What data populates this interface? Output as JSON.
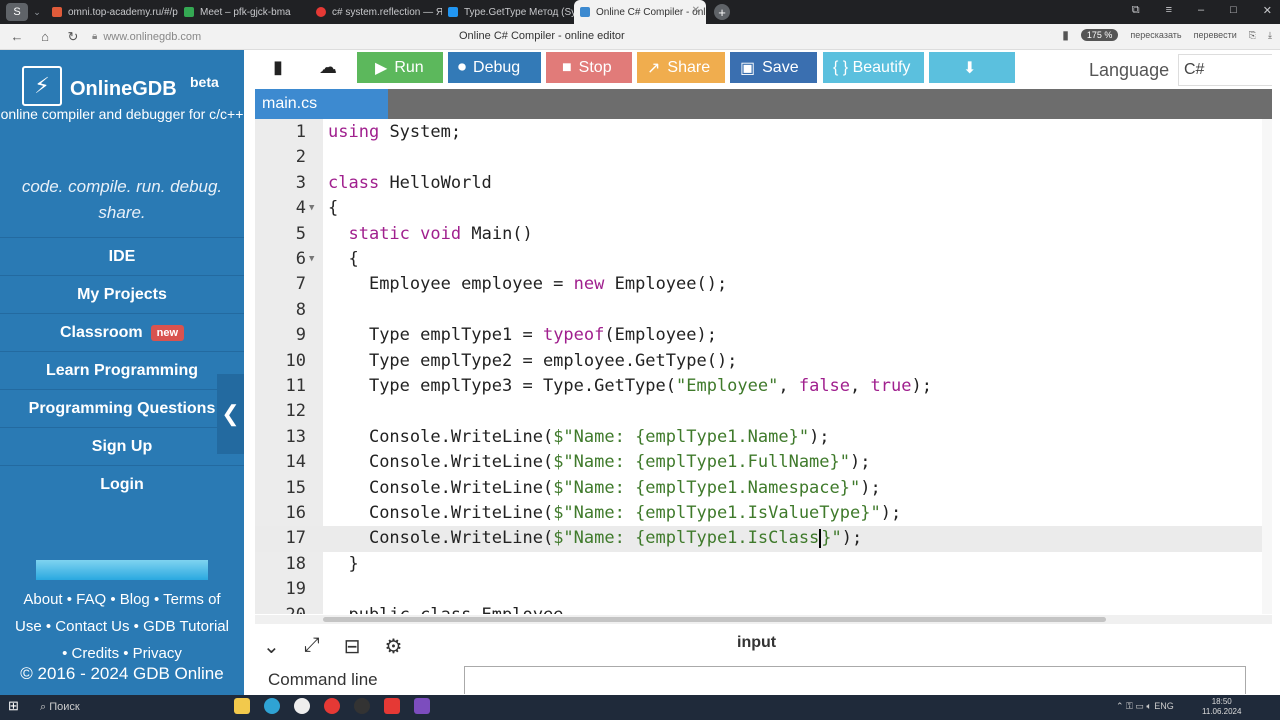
{
  "browser": {
    "tabs": [
      {
        "title": "omni.top-academy.ru/#/p",
        "color": "#e05b3a"
      },
      {
        "title": "Meet – pfk-gjck-bma",
        "color": "#34a853"
      },
      {
        "title": "c# system.reflection — Ян",
        "color": "#e53935"
      },
      {
        "title": "Type.GetType Метод (Sys",
        "color": "#2196f3"
      },
      {
        "title": "Online C# Compiler - onl",
        "color": "#3d8ad0",
        "active": true
      }
    ],
    "url": "www.onlinegdb.com",
    "page_title": "Online C# Compiler - online editor",
    "zoom": "175 %",
    "retell": "пересказать",
    "translate": "перевести"
  },
  "sidebar": {
    "brand_name": "OnlineGDB",
    "brand_beta": "beta",
    "subtitle": "online compiler and debugger for c/c++",
    "slogan": "code. compile. run. debug. share.",
    "menu": [
      "IDE",
      "My Projects",
      "Classroom",
      "Learn Programming",
      "Programming Questions",
      "Sign Up",
      "Login"
    ],
    "new_badge": "new",
    "footer_line1": "About • FAQ • Blog • Terms of",
    "footer_line2": "Use • Contact Us • GDB Tutorial",
    "footer_line3": "• Credits • Privacy",
    "copyright": "© 2016 - 2024 GDB Online"
  },
  "toolbar": {
    "run": "Run",
    "debug": "Debug",
    "stop": "Stop",
    "share": "Share",
    "save": "Save",
    "beautify": "{ } Beautify",
    "language_label": "Language",
    "language_value": "C#",
    "colors": {
      "run": "#5cb85c",
      "debug": "#337ab7",
      "stop": "#e17b79",
      "share": "#f0ad4e",
      "save": "#3a6fb0",
      "beautify": "#5bc0de",
      "download": "#5bc0de"
    }
  },
  "file_tab": "main.cs",
  "code_lines": [
    "1",
    "2",
    "3",
    "4",
    "5",
    "6",
    "7",
    "8",
    "9",
    "10",
    "11",
    "12",
    "13",
    "14",
    "15",
    "16",
    "17",
    "18",
    "19",
    "20"
  ],
  "code_text": {
    "l1": "System;",
    "l3": "HelloWorld",
    "l4": "{",
    "l5b": "Main()",
    "l6": "{",
    "l7a": "Employee employee = ",
    "l7b": "Employee();",
    "l9a": "Type emplType1 = ",
    "l9b": "(Employee);",
    "l10": "Type emplType2 = employee.GetType();",
    "l11a": "Type emplType3 = Type.GetType(",
    "l11s": "\"Employee\"",
    "l11c": ", ",
    "l11f": "false",
    "l11d": ", ",
    "l11t": "true",
    "l11e": ");",
    "cw": "Console.WriteLine(",
    "s13": "$\"Name: {emplType1.Name}\"",
    "s14": "$\"Name: {emplType1.FullName}\"",
    "s15": "$\"Name: {emplType1.Namespace}\"",
    "s16": "$\"Name: {emplType1.IsValueType}\"",
    "s17a": "$\"Name: {emplType1.IsClass",
    "s17b": "}\"",
    "end": ");",
    "l18": "}",
    "l20": "public class Employee"
  },
  "keywords": {
    "using": "using",
    "class": "class",
    "static": "static",
    "void": "void",
    "new": "new",
    "typeof": "typeof"
  },
  "bottom": {
    "input_label": "input",
    "command_line_label": "Command line"
  },
  "taskbar": {
    "search_placeholder": "Поиск",
    "lang": "ENG",
    "time": "18:50",
    "date": "11.06.2024"
  }
}
